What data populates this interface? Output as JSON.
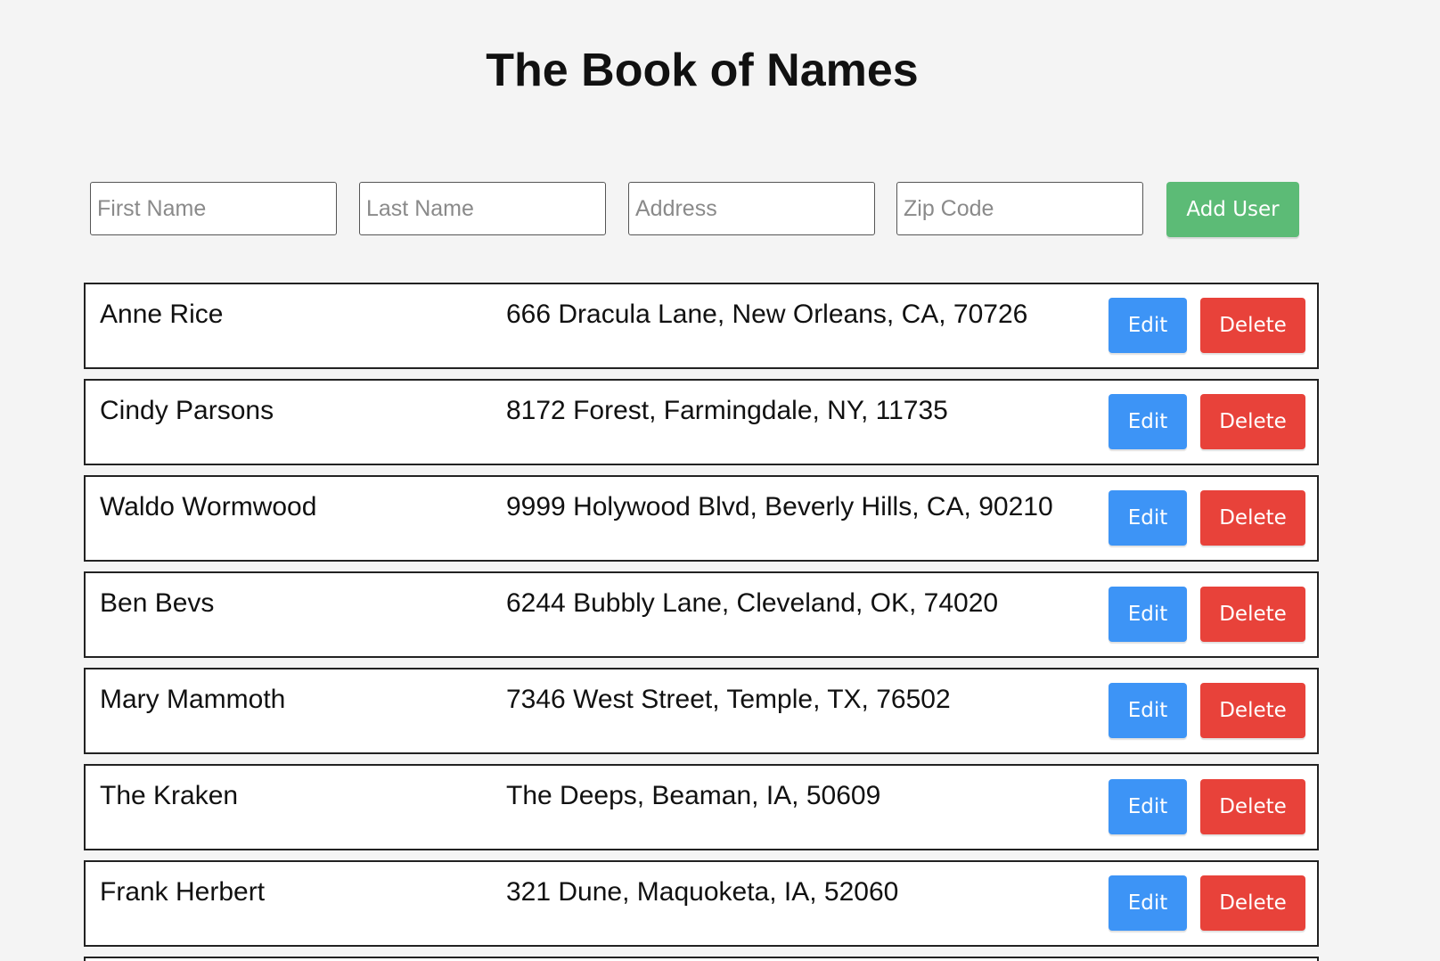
{
  "header": {
    "title": "The Book of Names"
  },
  "form": {
    "first_name_placeholder": "First Name",
    "last_name_placeholder": "Last Name",
    "address_placeholder": "Address",
    "zip_placeholder": "Zip Code",
    "add_label": "Add User"
  },
  "users": [
    {
      "name": "Anne Rice",
      "address": "666 Dracula Lane, New Orleans, CA, 70726",
      "edit_label": "Edit",
      "delete_label": "Delete"
    },
    {
      "name": "Cindy Parsons",
      "address": "8172 Forest, Farmingdale, NY, 11735",
      "edit_label": "Edit",
      "delete_label": "Delete"
    },
    {
      "name": "Waldo Wormwood",
      "address": "9999 Holywood Blvd, Beverly Hills, CA, 90210",
      "edit_label": "Edit",
      "delete_label": "Delete"
    },
    {
      "name": "Ben Bevs",
      "address": "6244 Bubbly Lane, Cleveland, OK, 74020",
      "edit_label": "Edit",
      "delete_label": "Delete"
    },
    {
      "name": "Mary Mammoth",
      "address": "7346 West Street, Temple, TX, 76502",
      "edit_label": "Edit",
      "delete_label": "Delete"
    },
    {
      "name": "The Kraken",
      "address": "The Deeps, Beaman, IA, 50609",
      "edit_label": "Edit",
      "delete_label": "Delete"
    },
    {
      "name": "Frank Herbert",
      "address": "321 Dune, Maquoketa, IA, 52060",
      "edit_label": "Edit",
      "delete_label": "Delete"
    }
  ],
  "colors": {
    "add_button": "#5cbb76",
    "edit_button": "#3d94f6",
    "delete_button": "#e8423a",
    "background": "#f4f4f4"
  }
}
